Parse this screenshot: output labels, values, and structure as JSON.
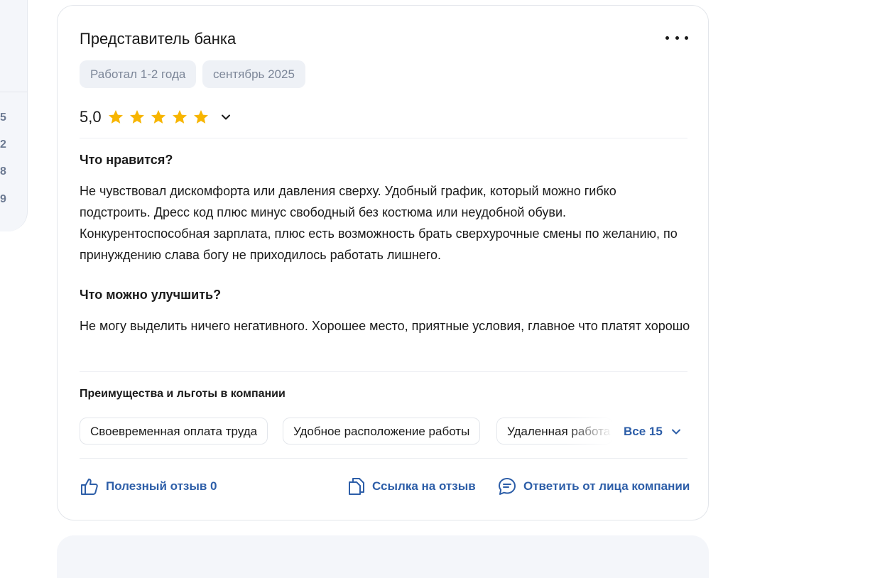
{
  "left_panel": {
    "numbers": [
      "5",
      "2",
      "8",
      "9"
    ]
  },
  "review": {
    "title": "Представитель банка",
    "tags": [
      "Работал 1-2 года",
      "сентябрь 2025"
    ],
    "rating": "5,0",
    "stars": 5,
    "likes_heading": "Что нравится?",
    "likes_text": "Не чувствовал дискомфорта или давления сверху. Удобный график, который можно гибко подстроить. Дресс код плюс минус свободный без костюма или неудобной обуви. Конкурентоспособная зарплата, плюс есть возможность брать сверхурочные смены по желанию, по принуждению слава богу не приходилось работать лишнего.",
    "improve_heading": "Что можно улучшить?",
    "improve_text": "Не могу выделить ничего негативного. Хорошее место, приятные условия, главное что платят хорошо",
    "benefits_heading": "Преимущества и льготы в компании",
    "benefits": [
      "Своевременная оплата труда",
      "Удобное расположение работы",
      "Удаленная работа"
    ],
    "benefits_all_label": "Все 15",
    "actions": {
      "helpful": "Полезный отзыв 0",
      "link": "Ссылка на отзыв",
      "reply": "Ответить от лица компании"
    }
  },
  "colors": {
    "accent": "#2d5ea8",
    "star": "#f7b500",
    "chip_bg": "#eef1f6",
    "chip_text": "#7c8698"
  }
}
